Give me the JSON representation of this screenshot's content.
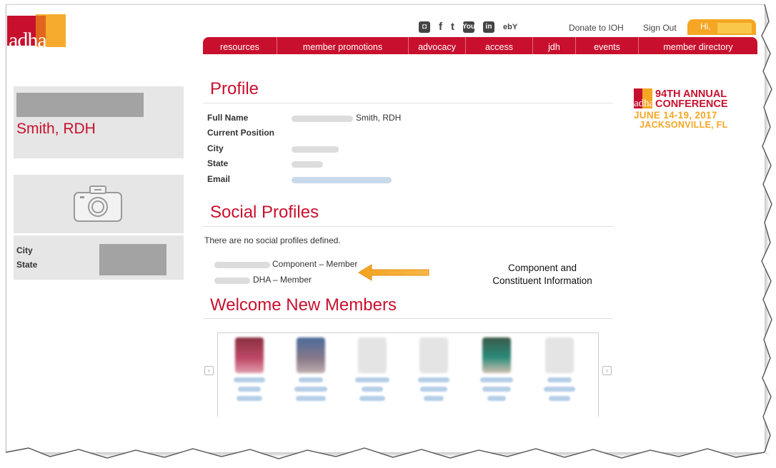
{
  "brand": {
    "logo_text": "adha",
    "accent": "#c8102e",
    "secondary": "#f5a623"
  },
  "utility": {
    "social_icons": [
      "instagram-icon",
      "facebook-icon",
      "tumblr-icon",
      "youtube-icon",
      "linkedin-icon",
      "ebay-icon"
    ],
    "youtube_label": "You",
    "linkedin_label": "in",
    "ebay_label": "ebY",
    "donate": "Donate to IOH",
    "sign_out": "Sign Out",
    "greeting": "Hi,"
  },
  "nav": {
    "items": [
      {
        "label": "resources"
      },
      {
        "label": "member promotions"
      },
      {
        "label": "advocacy"
      },
      {
        "label": "access"
      },
      {
        "label": "jdh"
      },
      {
        "label": "events"
      },
      {
        "label": "member directory"
      }
    ]
  },
  "sidebar": {
    "name": "Smith, RDH",
    "city_label": "City",
    "state_label": "State"
  },
  "profile": {
    "heading": "Profile",
    "fields": {
      "full_name_label": "Full Name",
      "full_name_value": "Smith, RDH",
      "position_label": "Current Position",
      "city_label": "City",
      "state_label": "State",
      "email_label": "Email"
    }
  },
  "social": {
    "heading": "Social Profiles",
    "empty_text": "There are no social profiles defined.",
    "component": "Component – Member",
    "constituent": "DHA – Member"
  },
  "annotation": {
    "line1": "Component and",
    "line2": "Constituent Information",
    "arrow_color": "#f5a623"
  },
  "welcome": {
    "heading": "Welcome New Members",
    "prev": "‹",
    "next": "›"
  },
  "conference": {
    "logo_text": "adha",
    "line1": "94TH ANNUAL",
    "line2": "CONFERENCE",
    "line3": "JUNE 14-19, 2017",
    "line4": "JACKSONVILLE, FL"
  }
}
